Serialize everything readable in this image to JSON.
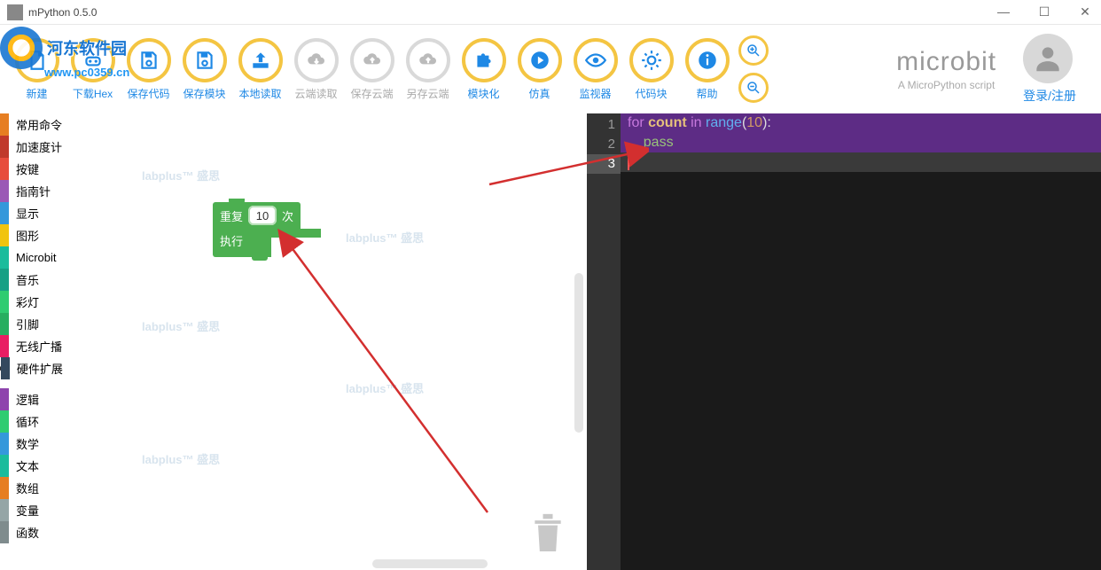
{
  "window": {
    "title": "mPython 0.5.0"
  },
  "winControls": {
    "min": "—",
    "max": "☐",
    "close": "✕"
  },
  "watermark": {
    "name": "河东软件园",
    "url": "www.pc0359.cn"
  },
  "toolbar": {
    "items": [
      {
        "id": "new",
        "label": "新建",
        "gray": false,
        "icon": "file"
      },
      {
        "id": "download-hex",
        "label": "下载Hex",
        "gray": false,
        "icon": "chip"
      },
      {
        "id": "save-code",
        "label": "保存代码",
        "gray": false,
        "icon": "save"
      },
      {
        "id": "save-module",
        "label": "保存模块",
        "gray": false,
        "icon": "save"
      },
      {
        "id": "local-read",
        "label": "本地读取",
        "gray": false,
        "icon": "upload"
      },
      {
        "id": "cloud-read",
        "label": "云端读取",
        "gray": true,
        "icon": "cloud-down"
      },
      {
        "id": "save-cloud",
        "label": "保存云端",
        "gray": true,
        "icon": "cloud-up"
      },
      {
        "id": "saveas-cloud",
        "label": "另存云端",
        "gray": true,
        "icon": "cloud-up"
      },
      {
        "id": "modularize",
        "label": "模块化",
        "gray": false,
        "icon": "puzzle"
      },
      {
        "id": "simulate",
        "label": "仿真",
        "gray": false,
        "icon": "play"
      },
      {
        "id": "monitor",
        "label": "监视器",
        "gray": false,
        "icon": "eye"
      },
      {
        "id": "codeblock",
        "label": "代码块",
        "gray": false,
        "icon": "gear"
      },
      {
        "id": "help",
        "label": "帮助",
        "gray": false,
        "icon": "info"
      }
    ]
  },
  "brand": {
    "title": "microbit",
    "subtitle": "A MicroPython script",
    "login": "登录/注册"
  },
  "categories": [
    {
      "label": "常用命令",
      "color": "#E67E22"
    },
    {
      "label": "加速度计",
      "color": "#C0392B"
    },
    {
      "label": "按键",
      "color": "#E74C3C"
    },
    {
      "label": "指南针",
      "color": "#9B59B6"
    },
    {
      "label": "显示",
      "color": "#3498DB"
    },
    {
      "label": "图形",
      "color": "#F1C40F"
    },
    {
      "label": "Microbit",
      "color": "#1ABC9C"
    },
    {
      "label": "音乐",
      "color": "#16A085"
    },
    {
      "label": "彩灯",
      "color": "#2ECC71"
    },
    {
      "label": "引脚",
      "color": "#27AE60"
    },
    {
      "label": "无线广播",
      "color": "#E91E63"
    },
    {
      "label": "硬件扩展",
      "color": "#34495E",
      "expand": true
    }
  ],
  "categories2": [
    {
      "label": "逻辑",
      "color": "#8E44AD"
    },
    {
      "label": "循环",
      "color": "#2ECC71"
    },
    {
      "label": "数学",
      "color": "#3498DB"
    },
    {
      "label": "文本",
      "color": "#1ABC9C"
    },
    {
      "label": "数组",
      "color": "#E67E22"
    },
    {
      "label": "变量",
      "color": "#95A5A6"
    },
    {
      "label": "函数",
      "color": "#7F8C8D"
    }
  ],
  "block": {
    "repeat_label": "重复",
    "times_label": "次",
    "exec_label": "执行",
    "count": "10"
  },
  "code": {
    "lines": [
      {
        "n": "1",
        "tokens": "for",
        "active": false
      },
      {
        "n": "2",
        "tokens": "pass",
        "active": false
      },
      {
        "n": "3",
        "tokens": "",
        "active": true
      }
    ],
    "kw": {
      "for": "for",
      "count": "count",
      "in": "in",
      "range": "range",
      "lpar": "(",
      "num": "10",
      "rpar": ")",
      "colon": ":",
      "pass": "pass",
      "indent": "    "
    }
  }
}
